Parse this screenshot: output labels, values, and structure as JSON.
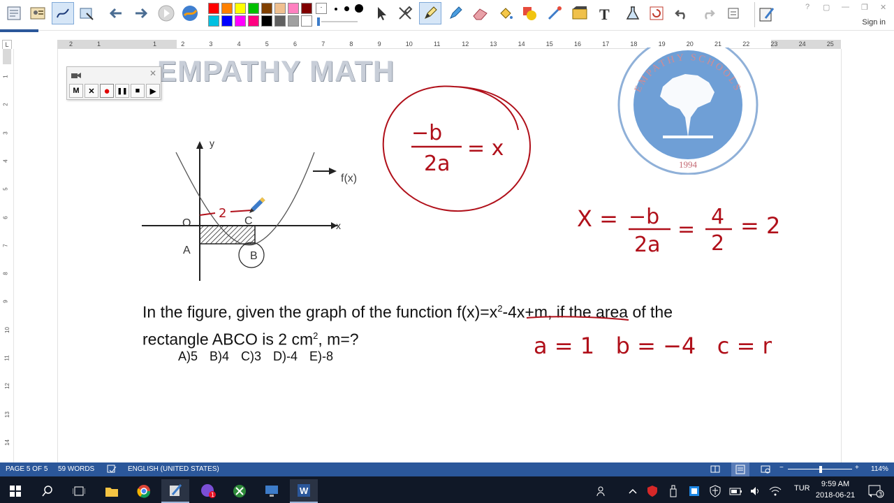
{
  "window": {
    "signin": "Sign in",
    "controls": [
      "?",
      "▢",
      "—",
      "❐",
      "✕"
    ]
  },
  "toolbar": {
    "palette": [
      "#ff0000",
      "#ff8000",
      "#ffff00",
      "#00c000",
      "#804000",
      "#f0c090",
      "#ff80c0",
      "#800000",
      "#00c0e0",
      "#0000ff",
      "#ff00ff",
      "#ff0080",
      "#000000",
      "#606060",
      "#a0a0a0",
      "#ffffff"
    ]
  },
  "ruler": {
    "horizontal": [
      "2",
      "1",
      "1",
      "2",
      "3",
      "4",
      "5",
      "6",
      "7",
      "8",
      "9",
      "10",
      "11",
      "12",
      "13",
      "14",
      "15",
      "16",
      "17",
      "18",
      "19",
      "20",
      "21",
      "22",
      "23",
      "24",
      "25"
    ],
    "vertical": [
      "1",
      "2",
      "3",
      "4",
      "5",
      "6",
      "7",
      "8",
      "9",
      "10",
      "11",
      "12",
      "13",
      "14"
    ],
    "corner": "L"
  },
  "recorder": {
    "buttons": [
      "M",
      "✕",
      "●",
      "❚❚",
      "■",
      "▶"
    ]
  },
  "document": {
    "heading": "EMPATHY MATH",
    "logo": {
      "arc_text": "EMPATHY SCHOOLS",
      "year": "1994"
    },
    "graph": {
      "y_label": "y",
      "x_label": "x",
      "f_label": "f(x)",
      "points": [
        "O",
        "A",
        "B",
        "C"
      ],
      "ink_label": "2"
    },
    "question_line1_a": "In the figure, given the graph of the function f(x)=x",
    "question_sup1": "2",
    "question_line1_b": "-4x+m, if the area of the",
    "question_line2_a": "rectangle ABCO is 2 cm",
    "question_sup2": "2",
    "question_line2_b": ", m=?",
    "options": [
      "A)5",
      "B)4",
      "C)3",
      "D)-4",
      "E)-8"
    ],
    "handwriting": {
      "vertex_formula": [
        "−b",
        "2a",
        "= x"
      ],
      "x_calc": [
        "X =",
        "−b",
        "2a",
        "=",
        "4",
        "2",
        "= 2"
      ],
      "coefficients": "a = 1   b = −4   c = m"
    },
    "ink_color": "#b0101a"
  },
  "statusbar": {
    "page": "PAGE 5 OF 5",
    "words": "59 WORDS",
    "language": "ENGLISH (UNITED STATES)",
    "zoom": "114%",
    "minus": "−",
    "plus": "+"
  },
  "taskbar": {
    "language": "TUR",
    "time": "9:59 AM",
    "date": "2018-06-21",
    "notifications": "3"
  }
}
